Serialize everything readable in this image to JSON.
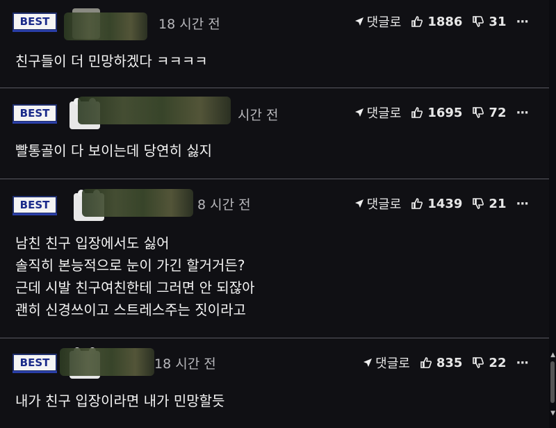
{
  "comments": [
    {
      "badge": "BEST",
      "time": "18 시간 전",
      "reply": "댓글로",
      "up": "1886",
      "down": "31",
      "more": "···",
      "lines": [
        "친구들이 더 민망하겠다 ㅋㅋㅋㅋ"
      ]
    },
    {
      "badge": "BEST",
      "time": "시간 전",
      "reply": "댓글로",
      "up": "1695",
      "down": "72",
      "more": "···",
      "lines": [
        "빨통골이 다 보이는데 당연히 싫지"
      ]
    },
    {
      "badge": "BEST",
      "time": "8 시간 전",
      "reply": "댓글로",
      "up": "1439",
      "down": "21",
      "more": "···",
      "lines": [
        "남친 친구 입장에서도 싫어",
        "솔직히 본능적으로 눈이 가긴 할거거든?",
        "근데 시발 친구여친한테 그러면 안 되잖아",
        "괜히 신경쓰이고 스트레스주는 짓이라고"
      ]
    },
    {
      "badge": "BEST",
      "time": "18 시간 전",
      "reply": "댓글로",
      "up": "835",
      "down": "22",
      "more": "···",
      "lines": [
        "내가 친구 입장이라면 내가 민망할듯"
      ]
    }
  ],
  "icons": {
    "reply": "reply-arrow-icon",
    "up": "thumbs-up-icon",
    "down": "thumbs-down-icon",
    "more": "more-dots-icon"
  },
  "colors": {
    "background": "#101014",
    "badge_text": "#1a2a8a",
    "badge_border": "#1e2d6b"
  }
}
